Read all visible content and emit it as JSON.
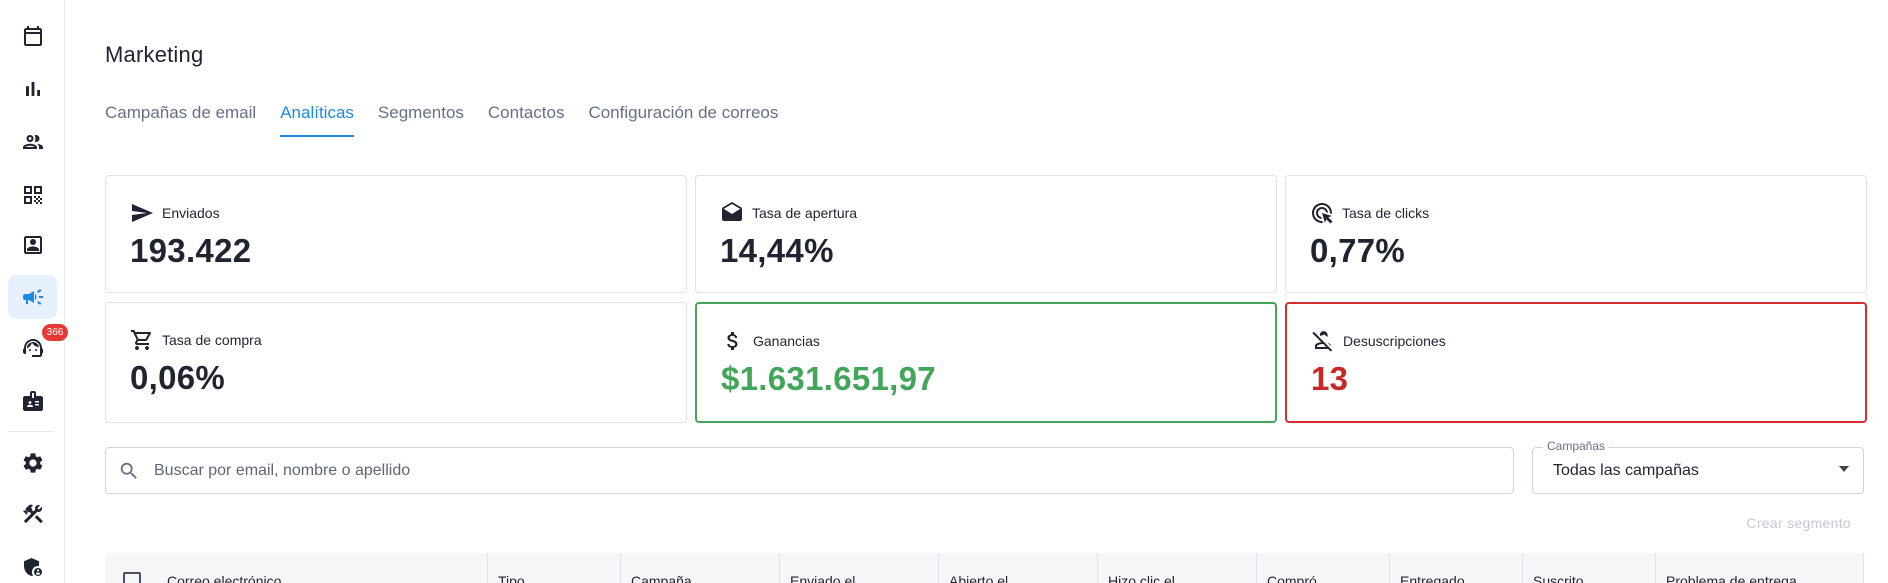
{
  "sidebar": {
    "items": [
      {
        "name": "calendar-icon"
      },
      {
        "name": "bar-chart-icon"
      },
      {
        "name": "people-icon"
      },
      {
        "name": "qr-code-icon"
      },
      {
        "name": "contact-card-icon"
      },
      {
        "name": "megaphone-icon",
        "active": true
      },
      {
        "name": "support-agent-icon",
        "badge": "366"
      },
      {
        "name": "badge-icon"
      },
      {
        "name": "settings-icon"
      },
      {
        "name": "tools-icon"
      },
      {
        "name": "admin-shield-icon"
      }
    ]
  },
  "header": {
    "title": "Marketing"
  },
  "tabs": [
    {
      "label": "Campañas de email"
    },
    {
      "label": "Analíticas",
      "active": true
    },
    {
      "label": "Segmentos"
    },
    {
      "label": "Contactos"
    },
    {
      "label": "Configuración de correos"
    }
  ],
  "stats": [
    {
      "label": "Enviados",
      "value": "193.422",
      "icon": "send-icon"
    },
    {
      "label": "Tasa de apertura",
      "value": "14,44%",
      "icon": "mail-open-icon"
    },
    {
      "label": "Tasa de clicks",
      "value": "0,77%",
      "icon": "ads-click-icon"
    },
    {
      "label": "Tasa de compra",
      "value": "0,06%",
      "icon": "shopping-cart-icon"
    },
    {
      "label": "Ganancias",
      "value": "$1.631.651,97",
      "icon": "dollar-icon",
      "accent": "#43a55a"
    },
    {
      "label": "Desuscripciones",
      "value": "13",
      "icon": "person-off-icon",
      "accent": "#c62828"
    }
  ],
  "search": {
    "placeholder": "Buscar por email, nombre o apellido",
    "value": ""
  },
  "campaign_filter": {
    "label": "Campañas",
    "value": "Todas las campañas"
  },
  "create_segment_label": "Crear segmento",
  "table": {
    "columns": [
      "Correo electrónico",
      "Tipo",
      "Campaña",
      "Enviado el",
      "Abierto el",
      "Hizo clic el",
      "Compró",
      "Entregado",
      "Suscrito",
      "Problema de entrega"
    ]
  },
  "colors": {
    "accent": "#1e88e5",
    "success": "#43a55a",
    "danger": "#c62828",
    "badge": "#e53935"
  }
}
